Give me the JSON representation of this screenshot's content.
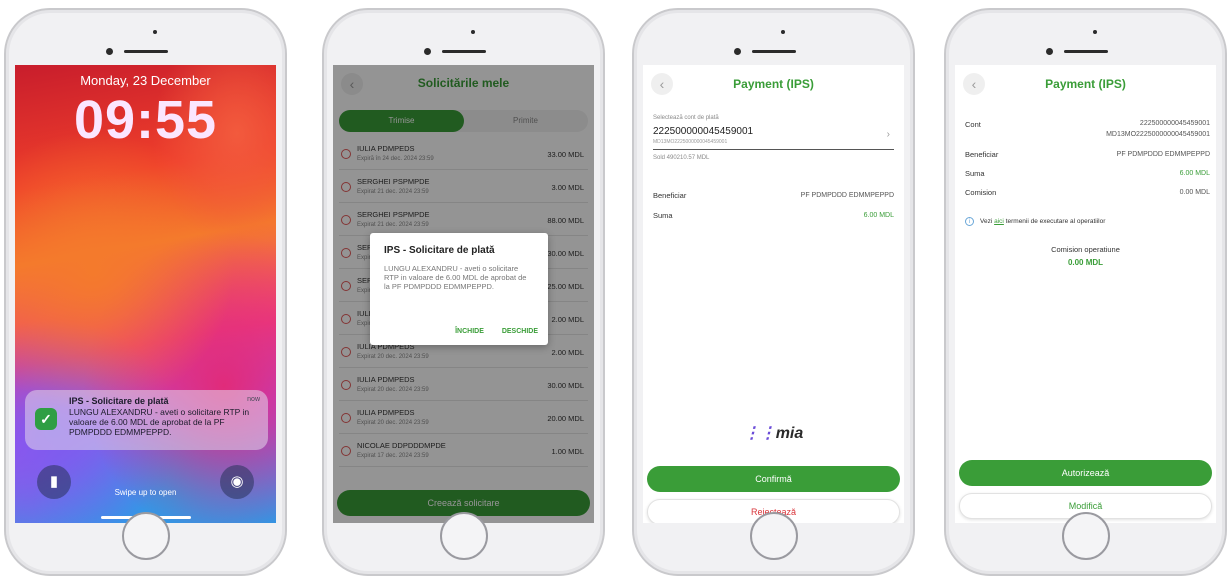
{
  "lockscreen": {
    "date": "Monday, 23 December",
    "time": "09:55",
    "notification": {
      "title": "IPS - Solicitare de plată",
      "time": "now",
      "body": "LUNGU ALEXANDRU - aveti o solicitare RTP in valoare de 6.00 MDL de aprobat de la PF PDMPDDD EDMMPEPPD."
    },
    "swipe_text": "Swipe up to open"
  },
  "requests": {
    "title": "Solicitările mele",
    "tabs": [
      "Trimise",
      "Primite"
    ],
    "rows": [
      {
        "name": "IULIA PDMPEDS",
        "sub": "Expiră în 24 dec. 2024 23:59",
        "amount": "33.00 MDL"
      },
      {
        "name": "SERGHEI PSPMPDE",
        "sub": "Expirat 21 dec. 2024 23:59",
        "amount": "3.00 MDL"
      },
      {
        "name": "SERGHEI PSPMPDE",
        "sub": "Expirat 21 dec. 2024 23:59",
        "amount": "88.00 MDL"
      },
      {
        "name": "SERGHEI PSPMPDE",
        "sub": "Expirat 21 dec. 2024 23:59",
        "amount": "30.00 MDL"
      },
      {
        "name": "SERGHEI PSPMPDE",
        "sub": "Expirat 21 dec. 2024 23:59",
        "amount": "25.00 MDL"
      },
      {
        "name": "IULIA PDMPEDS",
        "sub": "Expirat 20 dec. 2024 23:59",
        "amount": "2.00 MDL"
      },
      {
        "name": "IULIA PDMPEDS",
        "sub": "Expirat 20 dec. 2024 23:59",
        "amount": "2.00 MDL"
      },
      {
        "name": "IULIA PDMPEDS",
        "sub": "Expirat 20 dec. 2024 23:59",
        "amount": "30.00 MDL"
      },
      {
        "name": "IULIA PDMPEDS",
        "sub": "Expirat 20 dec. 2024 23:59",
        "amount": "20.00 MDL"
      },
      {
        "name": "NICOLAE DDPDDDMPDE",
        "sub": "Expirat 17 dec. 2024 23:59",
        "amount": "1.00 MDL"
      }
    ],
    "create_button": "Creează solicitare",
    "dialog": {
      "title": "IPS - Solicitare de plată",
      "body": "LUNGU ALEXANDRU - aveti o solicitare RTP in valoare de 6.00 MDL de aprobat de la PF PDMPDDD EDMMPEPPD.",
      "close": "ÎNCHIDE",
      "open": "DESCHIDE"
    }
  },
  "payment": {
    "title": "Payment (IPS)",
    "select_label": "Selectează cont de plată",
    "account": "222500000045459001",
    "account_iban": "MD13MO2225000000045459001",
    "balance": "Sold 490210.57 MDL",
    "beneficiary_label": "Beneficiar",
    "beneficiary_value": "PF PDMPDDD EDMMPEPPD",
    "amount_label": "Suma",
    "amount_value": "6.00 MDL",
    "logo": "mia",
    "confirm": "Confirmă",
    "reject": "Rejectează"
  },
  "authorize": {
    "title": "Payment (IPS)",
    "account_label": "Cont",
    "account_value": "222500000045459001",
    "account_iban": "MD13MO2225000000045459001",
    "beneficiary_label": "Beneficiar",
    "beneficiary_value": "PF PDMPDDD EDMMPEPPD",
    "amount_label": "Suma",
    "amount_value": "6.00 MDL",
    "fee_label": "Comision",
    "fee_value": "0.00 MDL",
    "info_pre": "Vezi",
    "info_link": "aici",
    "info_post": "termenii de executare al operatiilor",
    "op_fee_label": "Comision operatiune",
    "op_fee_value": "0.00 MDL",
    "authorize_button": "Autorizează",
    "modify_button": "Modifică"
  },
  "colors": {
    "brand_green": "#3a9d38",
    "reject_red": "#d9343a"
  }
}
